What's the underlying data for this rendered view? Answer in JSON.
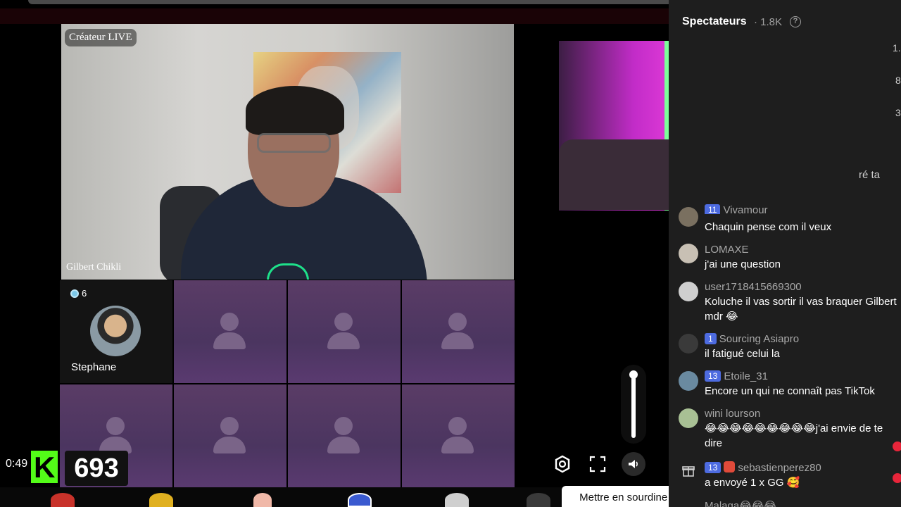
{
  "stream": {
    "host_label": "Créateur LIVE",
    "host_name": "Gilbert Chikli",
    "timer": "0:49",
    "viewer_count": "693",
    "kick_letter": "K"
  },
  "guests": [
    {
      "name": "Stephane",
      "badge": "6",
      "occupied": true
    },
    {
      "occupied": false
    },
    {
      "occupied": false
    },
    {
      "occupied": false
    },
    {
      "occupied": false
    },
    {
      "occupied": false
    },
    {
      "occupied": false
    },
    {
      "occupied": false
    }
  ],
  "controls": {
    "tooltip": "Mettre en sourdine (M)",
    "icons": [
      "settings-icon",
      "fullscreen-icon",
      "mute-icon"
    ]
  },
  "sidebar": {
    "title": "Spectateurs",
    "count": "· 1.8K",
    "ghost": [
      "1.",
      "8",
      "3",
      "ré ta"
    ],
    "comments": [
      {
        "user": "Vivamour",
        "level": "11",
        "text": "Chaquin pense com il veux"
      },
      {
        "user": "LOMAXE",
        "text": "j'ai une question"
      },
      {
        "user": "user1718415669300",
        "text": "Koluche il vas sortir il vas braquer Gilbert mdr 😂"
      },
      {
        "user": "Sourcing Asiapro",
        "level": "1",
        "text": "il fatigué celui la"
      },
      {
        "user": "Etoile_31",
        "level": "13",
        "text": "Encore un qui ne connaît pas TikTok"
      },
      {
        "user": "wini lourson",
        "text": "😂😂😂😂😂😂😂😂😂j'ai envie de te dire"
      },
      {
        "user": "sebastienperez80",
        "level": "13",
        "text": "a envoyé 1 x GG 🥰"
      },
      {
        "user": "Malaga",
        "text": "Malaga😂😂😂"
      }
    ]
  },
  "colors": {
    "kick_green": "#53fc18",
    "level_blue": "#4d6be0",
    "tile_purple": "#4b3560"
  }
}
